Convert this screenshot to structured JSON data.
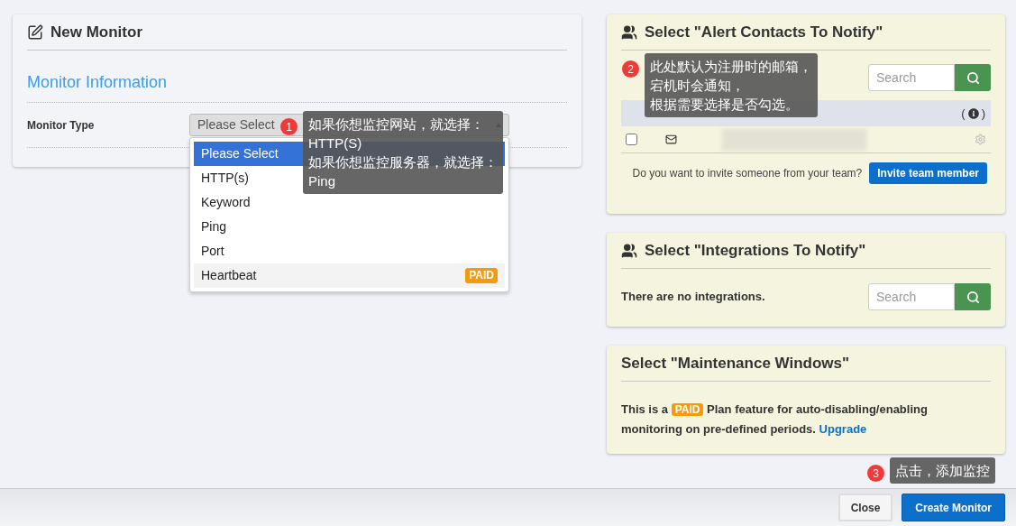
{
  "new_monitor": {
    "title": "New Monitor",
    "section": "Monitor Information",
    "field_label": "Monitor Type",
    "select": {
      "value": "Please Select",
      "expanded": true,
      "options": [
        {
          "label": "Please Select",
          "selected": true
        },
        {
          "label": "HTTP(s)",
          "selected": false
        },
        {
          "label": "Keyword",
          "selected": false
        },
        {
          "label": "Ping",
          "selected": false
        },
        {
          "label": "Port",
          "selected": false
        },
        {
          "label": "Heartbeat",
          "selected": false,
          "badge": "PAID"
        }
      ]
    }
  },
  "alert_contacts": {
    "title": "Select \"Alert Contacts To Notify\"",
    "search_placeholder": "Search",
    "info_open": "(",
    "info_close": ")",
    "contacts": [
      {
        "checked": false
      }
    ],
    "invite_text": "Do you want to invite someone from your team?",
    "invite_button": "Invite team member"
  },
  "integrations": {
    "title": "Select \"Integrations To Notify\"",
    "empty_text": "There are no integrations.",
    "search_placeholder": "Search"
  },
  "maintenance": {
    "title": "Select \"Maintenance Windows\"",
    "text_before": "This is a",
    "badge": "PAID",
    "text_after": "Plan feature for auto-disabling/enabling monitoring on pre-defined periods.",
    "link": "Upgrade"
  },
  "footer_buttons": [
    {
      "label": "Close",
      "kind": "secondary"
    },
    {
      "label": "Create Monitor",
      "kind": "primary"
    }
  ],
  "annotations": [
    {
      "number": "1",
      "lines": [
        "如果你想监控网站，就选择：",
        "HTTP(S)",
        "如果你想监控服务器，就选择：",
        "Ping"
      ]
    },
    {
      "number": "2",
      "lines": [
        "此处默认为注册时的邮箱，",
        "宕机时会通知，",
        "根据需要选择是否勾选。"
      ]
    },
    {
      "number": "3",
      "lines": [
        "点击，添加监控"
      ]
    }
  ]
}
